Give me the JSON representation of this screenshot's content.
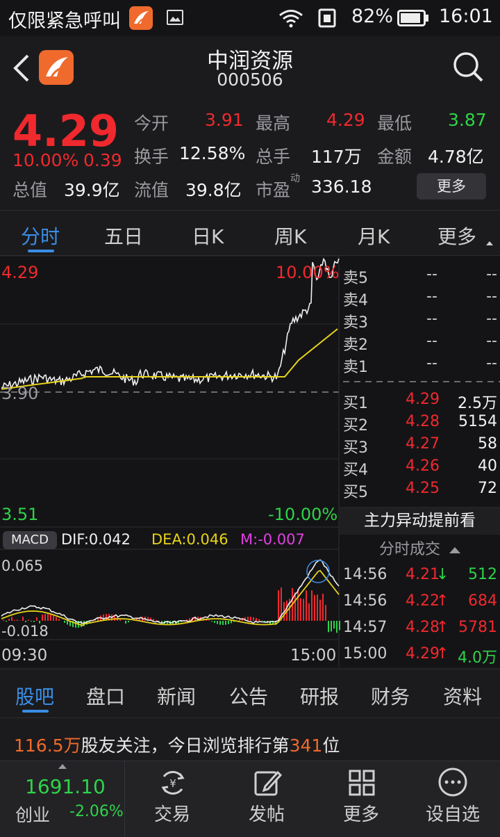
{
  "status_bar": {
    "carrier": "仅限紧急呼叫",
    "battery": "82%",
    "time": "16:01"
  },
  "header": {
    "title": "中润资源",
    "code": "000506"
  },
  "quote": {
    "price": "4.29",
    "change_pct": "10.00%",
    "change": "0.39",
    "labels": {
      "open": "今开",
      "high": "最高",
      "low": "最低",
      "turnover": "换手",
      "volume": "总手",
      "amount": "金额",
      "market_cap": "总值",
      "float_cap": "流值",
      "pe": "市盈",
      "pe_sup": "动"
    },
    "values": {
      "open": "3.91",
      "high": "4.29",
      "low": "3.87",
      "turnover": "12.58%",
      "volume": "117万",
      "amount": "4.78亿",
      "market_cap": "39.9亿",
      "float_cap": "39.8亿",
      "pe": "336.18"
    },
    "more": "更多"
  },
  "tabs": [
    "分时",
    "五日",
    "日K",
    "周K",
    "月K",
    "更多"
  ],
  "chart": {
    "price_high": "4.29",
    "price_mid": "3.90",
    "price_low": "3.51",
    "pct_high": "10.00%",
    "pct_low": "-10.00%",
    "macd_label": "MACD",
    "dif": "DIF:0.042",
    "dea": "DEA:0.046",
    "m": "M:-0.007",
    "macd_high": "0.065",
    "macd_low": "-0.018",
    "time_start": "09:30",
    "time_end": "15:00",
    "colors": {
      "price_line": "#f0f0f0",
      "avg_line": "#e7d31a",
      "up": "#f0292e",
      "down": "#2fd34a",
      "dea": "#e7d31a",
      "m": "#e040e0"
    }
  },
  "order_book": {
    "asks": [
      {
        "label": "卖5",
        "price": "--",
        "vol": "--"
      },
      {
        "label": "卖4",
        "price": "--",
        "vol": "--"
      },
      {
        "label": "卖3",
        "price": "--",
        "vol": "--"
      },
      {
        "label": "卖2",
        "price": "--",
        "vol": "--"
      },
      {
        "label": "卖1",
        "price": "--",
        "vol": "--"
      }
    ],
    "bids": [
      {
        "label": "买1",
        "price": "4.29",
        "vol": "2.5万"
      },
      {
        "label": "买2",
        "price": "4.28",
        "vol": "5154"
      },
      {
        "label": "买3",
        "price": "4.27",
        "vol": "58"
      },
      {
        "label": "买4",
        "price": "4.26",
        "vol": "40"
      },
      {
        "label": "买5",
        "price": "4.25",
        "vol": "72"
      }
    ],
    "main_force": "主力异动提前看",
    "ticks_title": "分时成交",
    "ticks": [
      {
        "time": "14:56",
        "price": "4.21",
        "arrow": "↓",
        "vol": "512",
        "dir": "down"
      },
      {
        "time": "14:56",
        "price": "4.22",
        "arrow": "↑",
        "vol": "684",
        "dir": "up"
      },
      {
        "time": "14:57",
        "price": "4.28",
        "arrow": "↑",
        "vol": "5781",
        "dir": "up"
      },
      {
        "time": "15:00",
        "price": "4.29",
        "arrow": "↑",
        "vol": "4.0万",
        "dir": "up2"
      }
    ]
  },
  "subtabs": [
    "股吧",
    "盘口",
    "新闻",
    "公告",
    "研报",
    "财务",
    "资料"
  ],
  "notice": {
    "count": "116.5万",
    "text1": "股友关注，今日浏览排行第",
    "rank": "341",
    "text2": "位"
  },
  "bottom_bar": {
    "index_value": "1691.10",
    "index_name": "创业",
    "index_change": "-2.06%",
    "items": [
      {
        "label": "交易",
        "icon": "yuan-exchange-icon"
      },
      {
        "label": "发帖",
        "icon": "edit-icon"
      },
      {
        "label": "更多",
        "icon": "grid-icon"
      },
      {
        "label": "设自选",
        "icon": "more-dots-icon"
      }
    ]
  }
}
